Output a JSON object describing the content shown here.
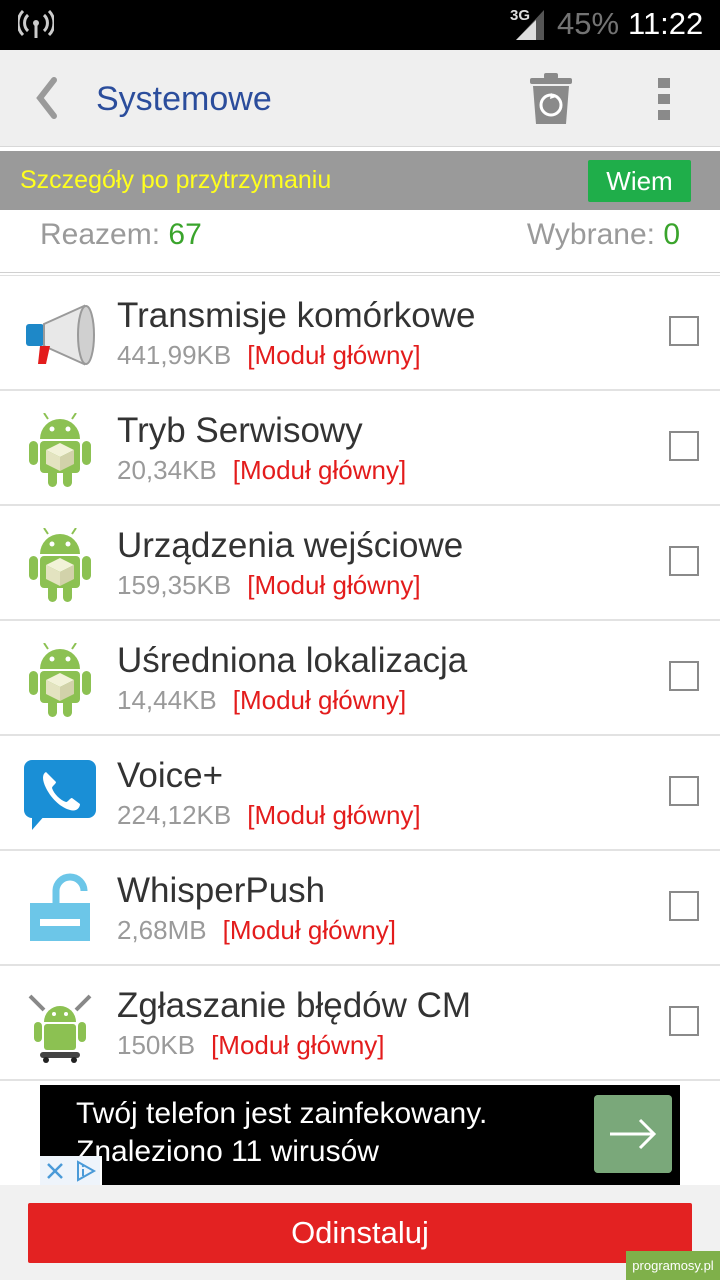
{
  "status_bar": {
    "network_type": "3G",
    "battery": "45%",
    "time": "11:22"
  },
  "app_bar": {
    "title": "Systemowe"
  },
  "hint_bar": {
    "text": "Szczegóły po przytrzymaniu",
    "button_label": "Wiem"
  },
  "totals": {
    "total_label": "Reazem: ",
    "total_value": "67",
    "selected_label": "Wybrane: ",
    "selected_value": "0"
  },
  "apps": [
    {
      "name": "Transmisje komórkowe",
      "size": "441,99KB",
      "tag": "[Moduł główny]",
      "icon": "megaphone-icon",
      "checked": false
    },
    {
      "name": "Tryb Serwisowy",
      "size": "20,34KB",
      "tag": "[Moduł główny]",
      "icon": "android-icon",
      "checked": false
    },
    {
      "name": "Urządzenia wejściowe",
      "size": "159,35KB",
      "tag": "[Moduł główny]",
      "icon": "android-icon",
      "checked": false
    },
    {
      "name": "Uśredniona lokalizacja",
      "size": "14,44KB",
      "tag": "[Moduł główny]",
      "icon": "android-icon",
      "checked": false
    },
    {
      "name": "Voice+",
      "size": "224,12KB",
      "tag": "[Moduł główny]",
      "icon": "phone-bubble-icon",
      "checked": false
    },
    {
      "name": "WhisperPush",
      "size": "2,68MB",
      "tag": "[Moduł główny]",
      "icon": "unlock-icon",
      "checked": false
    },
    {
      "name": "Zgłaszanie błędów CM",
      "size": "150KB",
      "tag": "[Moduł główny]",
      "icon": "android-tools-icon",
      "checked": false
    }
  ],
  "ad": {
    "line1": "Twój telefon jest zainfekowany.",
    "line2": "Znaleziono 11 wirusów"
  },
  "bottom": {
    "uninstall_label": "Odinstaluj"
  },
  "watermark": "programosy.pl",
  "colors": {
    "title": "#2b4d9c",
    "hint_text": "#ffff1e",
    "ok_button": "#1fae4a",
    "tag": "#e31c1c",
    "uninstall": "#e32222",
    "count_green": "#3aa42c"
  }
}
